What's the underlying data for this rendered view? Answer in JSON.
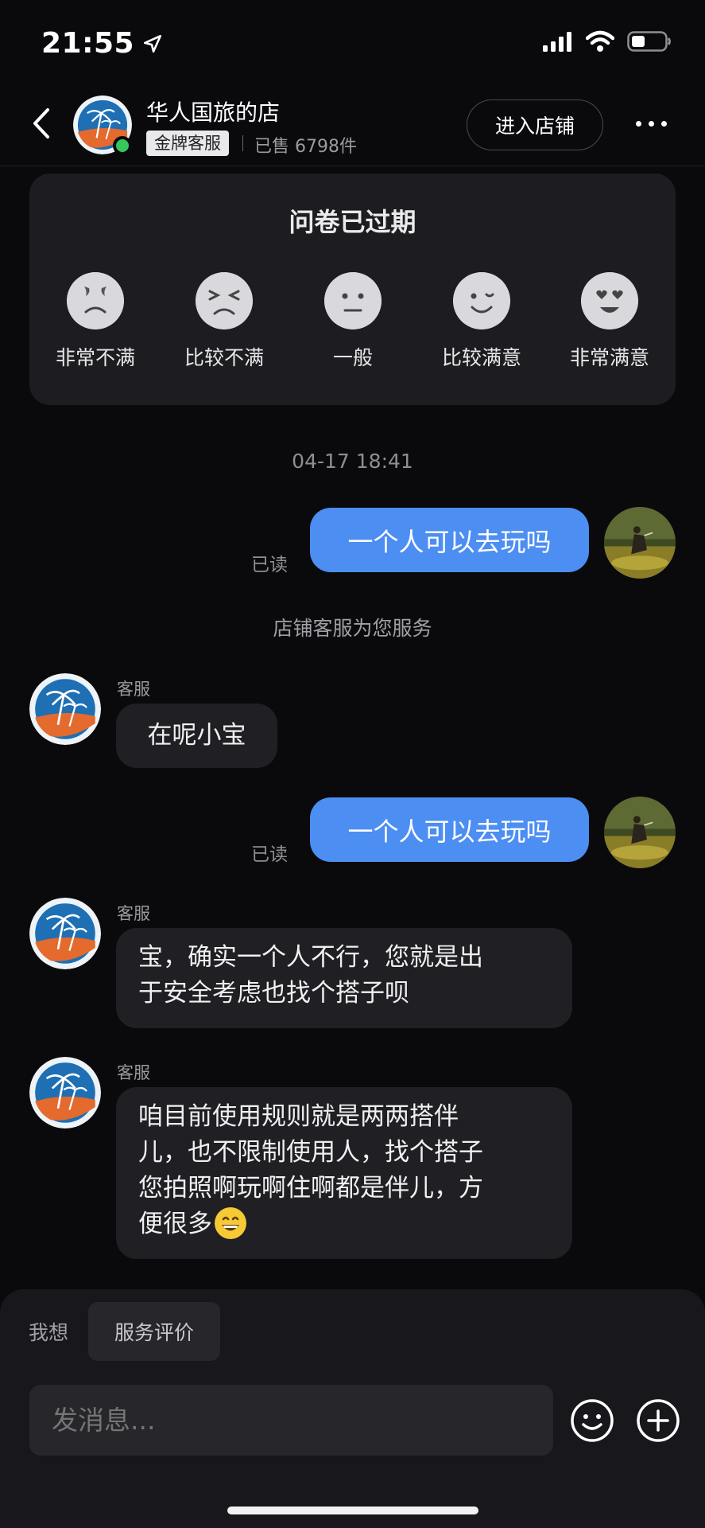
{
  "status": {
    "time": "21:55"
  },
  "header": {
    "shop_name": "华人国旅的店",
    "badge": "金牌客服",
    "sold": "已售 6798件",
    "enter_button": "进入店铺"
  },
  "survey": {
    "title": "问卷已过期",
    "options": [
      {
        "label": "非常不满",
        "icon": "very-unsatisfied-face"
      },
      {
        "label": "比较不满",
        "icon": "unsatisfied-face"
      },
      {
        "label": "一般",
        "icon": "neutral-face"
      },
      {
        "label": "比较满意",
        "icon": "satisfied-face"
      },
      {
        "label": "非常满意",
        "icon": "very-satisfied-face"
      }
    ]
  },
  "chat": {
    "timestamp": "04-17 18:41",
    "system_note": "店铺客服为您服务",
    "read_label": "已读",
    "agent_name": "客服",
    "messages": [
      {
        "from": "user",
        "text": "一个人可以去玩吗"
      },
      {
        "from": "agent",
        "text": "在呢小宝"
      },
      {
        "from": "user",
        "text": "一个人可以去玩吗"
      },
      {
        "from": "agent",
        "lines": [
          "宝，确实一个人不行，您就是出",
          "于安全考虑也找个搭子呗"
        ]
      },
      {
        "from": "agent",
        "lines": [
          "咱目前使用规则就是两两搭伴",
          "儿，也不限制使用人，找个搭子",
          "您拍照啊玩啊住啊都是伴儿，方",
          "便很多"
        ],
        "emoji": "😄"
      }
    ]
  },
  "bottom": {
    "wish_label": "我想",
    "quick_chip": "服务评价",
    "input_placeholder": "发消息..."
  },
  "colors": {
    "background": "#0a0a0d",
    "outgoing_bubble": "#4c8ef2",
    "incoming_bubble": "#1f1f24",
    "online": "#34c759"
  }
}
